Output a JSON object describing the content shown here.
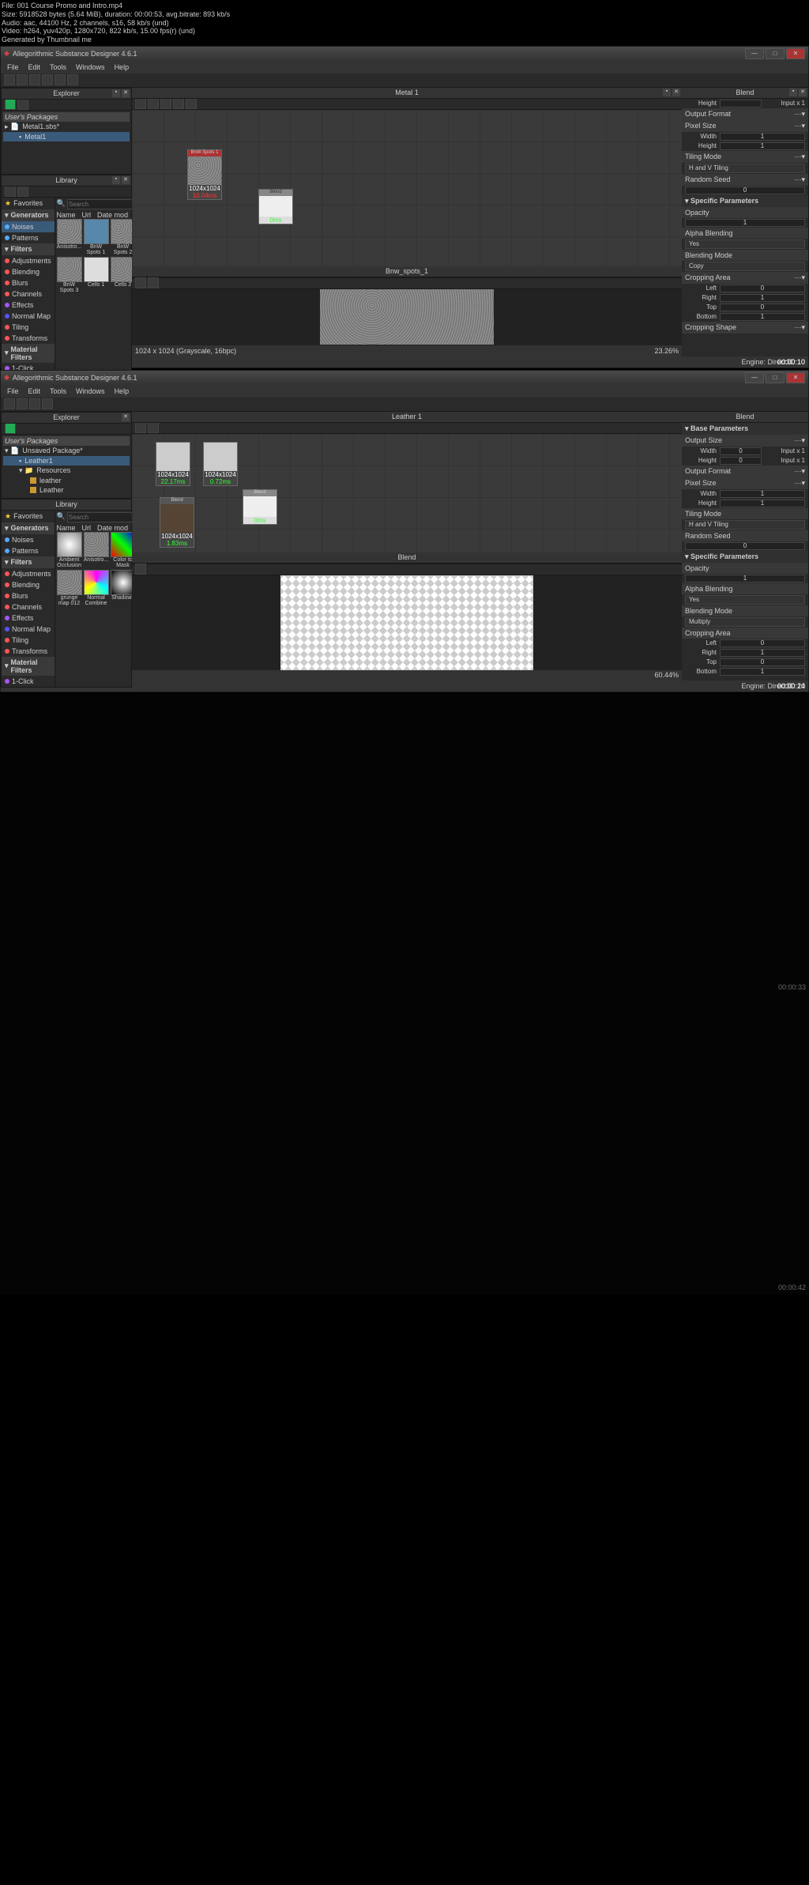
{
  "meta": {
    "file": "File: 001 Course Promo and Intro.mp4",
    "size": "Size: 5918528 bytes (5.64 MiB), duration: 00:00:53, avg.bitrate: 893 kb/s",
    "audio": "Audio: aac, 44100 Hz, 2 channels, s16, 58 kb/s (und)",
    "video": "Video: h264, yuv420p, 1280x720, 822 kb/s, 15.00 fps(r) (und)",
    "gen": "Generated by Thumbnail me"
  },
  "app_title": "Allegorithmic Substance Designer 4.6.1",
  "menus": [
    "File",
    "Edit",
    "Tools",
    "Windows",
    "Help"
  ],
  "panels": {
    "explorer": "Explorer",
    "library": "Library",
    "blend": "Blend"
  },
  "frame1": {
    "graph_title": "Metal 1",
    "preview_title": "Bnw_spots_1",
    "tree_usr": "User's Packages",
    "tree_pkg": "Metal1.sbs*",
    "tree_item": "Metal1",
    "node1_res": "1024x1024",
    "node1_time": "10.04ms",
    "node2_lbl": "Blend",
    "node2_time": "0ms",
    "preview_info": "1024 x 1024 (Grayscale, 16bpc)",
    "preview_zoom": "23.26%",
    "props": {
      "height_lbl": "Height",
      "height_txt": "Input x 1",
      "output_fmt": "Output Format",
      "pixel_size": "Pixel Size",
      "width_lbl": "Width",
      "width_val": "1",
      "height2_lbl": "Height",
      "height2_val": "1",
      "tiling": "Tiling Mode",
      "tiling_val": "H and V Tiling",
      "random": "Random Seed",
      "random_val": "0",
      "specific": "Specific Parameters",
      "opacity": "Opacity",
      "opacity_val": "1",
      "alpha": "Alpha Blending",
      "alpha_val": "Yes",
      "blendmode": "Blending Mode",
      "blendmode_val": "Copy",
      "cropping": "Cropping Area",
      "left": "Left",
      "left_val": "0",
      "right": "Right",
      "right_val": "1",
      "top": "Top",
      "top_val": "0",
      "bottom": "Bottom",
      "bottom_val": "1",
      "cropshape": "Cropping Shape"
    },
    "status": "Engine: Direct3D 10",
    "ts": "00:00:10"
  },
  "frame2": {
    "graph_title": "Leather 1",
    "preview_title": "Blend",
    "tree_usr": "User's Packages",
    "tree_pkg": "Unsaved Package*",
    "tree_item": "Leather1",
    "tree_res": "Resources",
    "tree_res1": "leather",
    "tree_res2": "Leather",
    "node1_res": "1024x1024",
    "node1_time": "22.17ms",
    "node2_res": "1024x1024",
    "node2_time": "0.72ms",
    "node3_res": "1024x1024",
    "node3_time": "1.83ms",
    "node4_time": "0ms",
    "preview_zoom": "60.44%",
    "props": {
      "base": "Base Parameters",
      "outsize": "Output Size",
      "width_lbl": "Width",
      "width_val": "0",
      "width_txt": "Input x 1",
      "height_lbl": "Height",
      "height_val": "0",
      "height_txt": "Input x 1",
      "output_fmt": "Output Format",
      "pixel_size": "Pixel Size",
      "pwidth": "Width",
      "pwidth_val": "1",
      "pheight": "Height",
      "pheight_val": "1",
      "tiling": "Tiling Mode",
      "tiling_val": "H and V Tiling",
      "random": "Random Seed",
      "random_val": "0",
      "specific": "Specific Parameters",
      "opacity": "Opacity",
      "opacity_val": "1",
      "alpha": "Alpha Blending",
      "alpha_val": "Yes",
      "blendmode": "Blending Mode",
      "blendmode_val": "Multiply",
      "cropping": "Cropping Area",
      "left": "Left",
      "left_val": "0",
      "right": "Right",
      "right_val": "1",
      "top": "Top",
      "top_val": "0",
      "bottom": "Bottom",
      "bottom_val": "1"
    },
    "status": "Engine: Direct3D 10",
    "ts": "00:00:24"
  },
  "frame3_ts": "00:00:33",
  "frame4_ts": "00:00:42",
  "lib": {
    "favorites": "Favorites",
    "generators": "Generators",
    "noises": "Noises",
    "patterns": "Patterns",
    "filters": "Filters",
    "adjustments": "Adjustments",
    "blending": "Blending",
    "blurs": "Blurs",
    "channels": "Channels",
    "effects": "Effects",
    "normalmap": "Normal Map",
    "tiling": "Tiling",
    "transforms": "Transforms",
    "matfilters": "Material Filters",
    "oneclick": "1-Click",
    "search": "Search",
    "name": "Name",
    "url": "Url",
    "date": "Date mod",
    "t1": "Anisotro...",
    "t2": "BnW Spots 1",
    "t3": "BnW Spots 2",
    "t4": "BnW Spots 3",
    "t5": "Cells 1",
    "t6": "Cells 2",
    "t7": "Ambient Occlusion",
    "t8": "Anisotro...",
    "t9": "Color to Mask",
    "t10": "grunge map 012",
    "t11": "Normal Combine",
    "t12": "Shadows"
  }
}
